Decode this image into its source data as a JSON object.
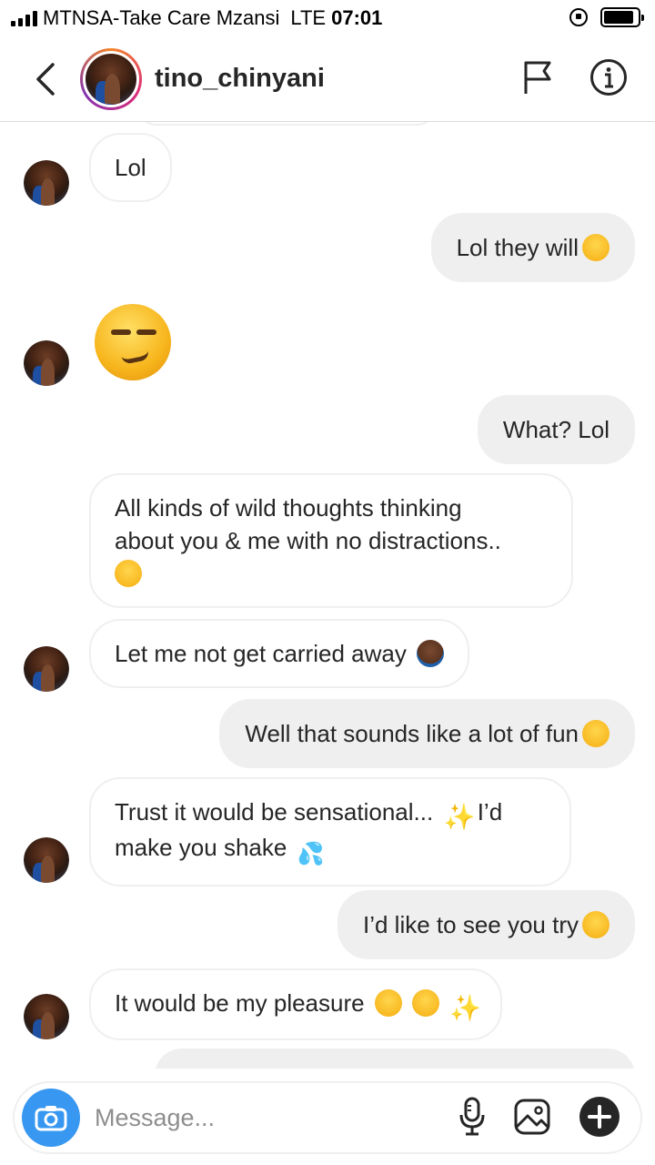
{
  "status_bar": {
    "carrier": "MTNSA-Take Care Mzansi",
    "network": "LTE",
    "time": "07:01"
  },
  "header": {
    "username": "tino_chinyani",
    "back_icon": "chevron-left-icon",
    "flag_icon": "flag-icon",
    "info_icon": "info-icon"
  },
  "messages": [
    {
      "direction": "in",
      "text": "Lol"
    },
    {
      "direction": "out",
      "text": "Lol they will",
      "emoji": "winking-face"
    },
    {
      "direction": "in",
      "text": "",
      "emoji": "smirking-face-large"
    },
    {
      "direction": "out",
      "text": "What? Lol"
    },
    {
      "direction": "in",
      "text_line1": "All kinds of wild thoughts thinking",
      "text_line2": "about you & me with no distractions..",
      "emoji": "relieved-face"
    },
    {
      "direction": "in",
      "text": "Let me not get carried away",
      "emoji": "person-gesturing-ok"
    },
    {
      "direction": "out",
      "text": "Well that sounds like a lot of fun",
      "emoji": "face-savoring-food"
    },
    {
      "direction": "in",
      "text_line1": "Trust it would be sensational...",
      "text_line1b": "I’d",
      "text_line2": "make you shake",
      "emoji": "sparkles, sweat-droplets"
    },
    {
      "direction": "out",
      "text": "I’d like to see you try",
      "emoji": "smiling-face"
    },
    {
      "direction": "in",
      "text": "It would be my pleasure",
      "emoji": "smirking-face, relieved-face, sparkles"
    }
  ],
  "composer": {
    "placeholder": "Message...",
    "camera_icon": "camera-icon",
    "mic_icon": "microphone-icon",
    "gallery_icon": "image-gallery-icon",
    "plus_icon": "plus-icon"
  },
  "colors": {
    "accent": "#3897f0",
    "outgoing_bubble": "#efefef",
    "text": "#262626"
  }
}
